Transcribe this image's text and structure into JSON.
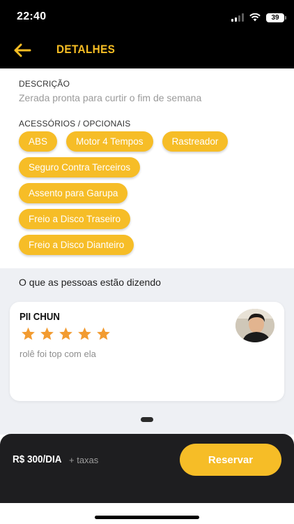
{
  "status_bar": {
    "time": "22:40",
    "battery": "39",
    "icons": [
      "signal-icon",
      "wifi-icon",
      "battery-icon"
    ]
  },
  "header": {
    "back_icon": "arrow-left-icon",
    "title": "DETALHES"
  },
  "description": {
    "label": "DESCRIÇÃO",
    "text": "Zerada pronta para curtir o fim de semana"
  },
  "accessories": {
    "label": "ACESSÓRIOS / OPCIONAIS",
    "items": [
      "ABS",
      "Motor 4 Tempos",
      "Rastreador",
      "Seguro Contra Terceiros",
      "Assento para Garupa",
      "Freio a Disco Traseiro",
      "Freio a Disco Dianteiro"
    ]
  },
  "reviews": {
    "heading": "O que as pessoas estão dizendo",
    "items": [
      {
        "name": "PII CHUN",
        "rating": 5,
        "text": "rolê foi top com ela",
        "avatar_icon": "user-avatar"
      }
    ],
    "pager": {
      "count": 1,
      "active": 0
    }
  },
  "footer": {
    "price": "R$ 300/DIA",
    "taxes": "+ taxas",
    "reserve_label": "Reservar"
  },
  "colors": {
    "accent": "#f6bd27",
    "header_bg": "#000000",
    "footer_bg": "#1e1e20",
    "reviews_bg": "#eef0f4",
    "star": "#f29b30"
  }
}
